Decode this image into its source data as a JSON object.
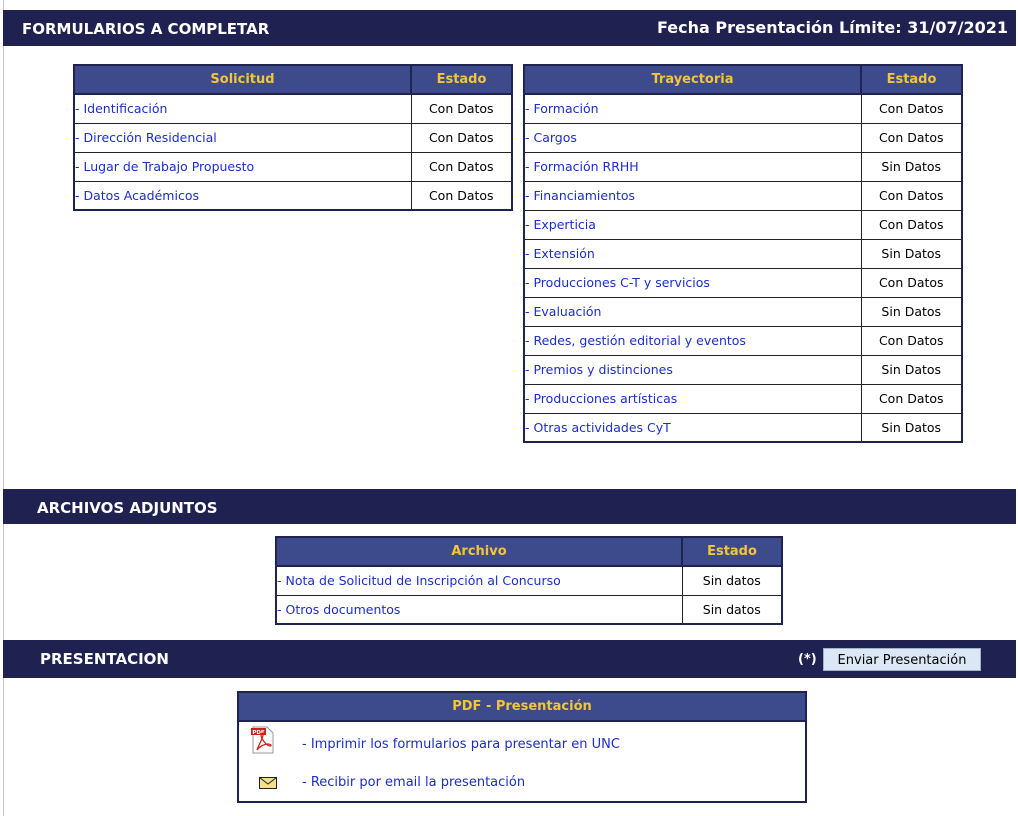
{
  "header": {
    "title": "FORMULARIOS A COMPLETAR",
    "deadline": "Fecha Presentación Límite: 31/07/2021"
  },
  "solicitud": {
    "col1": "Solicitud",
    "col2": "Estado",
    "rows": [
      {
        "label": "- Identificación",
        "status": "Con Datos"
      },
      {
        "label": "- Dirección Residencial",
        "status": "Con Datos"
      },
      {
        "label": "- Lugar de Trabajo Propuesto",
        "status": "Con Datos"
      },
      {
        "label": "- Datos Académicos",
        "status": "Con Datos"
      }
    ]
  },
  "trayectoria": {
    "col1": "Trayectoria",
    "col2": "Estado",
    "rows": [
      {
        "label": "- Formación",
        "status": "Con Datos"
      },
      {
        "label": "- Cargos",
        "status": "Con Datos"
      },
      {
        "label": "- Formación RRHH",
        "status": "Sin Datos"
      },
      {
        "label": "- Financiamientos",
        "status": "Con Datos"
      },
      {
        "label": "- Experticia",
        "status": "Con Datos"
      },
      {
        "label": "- Extensión",
        "status": "Sin Datos"
      },
      {
        "label": "- Producciones C-T y servicios",
        "status": "Con Datos"
      },
      {
        "label": "- Evaluación",
        "status": "Sin Datos"
      },
      {
        "label": "- Redes, gestión editorial y eventos",
        "status": "Con Datos"
      },
      {
        "label": "- Premios y distinciones",
        "status": "Sin Datos"
      },
      {
        "label": "- Producciones artísticas",
        "status": "Con Datos"
      },
      {
        "label": "- Otras actividades CyT",
        "status": "Sin Datos"
      }
    ]
  },
  "archivos": {
    "title": "ARCHIVOS ADJUNTOS",
    "col1": "Archivo",
    "col2": "Estado",
    "rows": [
      {
        "label": "- Nota de Solicitud de Inscripción al Concurso",
        "status": "Sin datos"
      },
      {
        "label": "- Otros documentos",
        "status": "Sin datos"
      }
    ]
  },
  "presentacion": {
    "title": "PRESENTACION",
    "asterisk": "(*)",
    "button": "Enviar Presentación",
    "pdf_title": "PDF - Presentación",
    "print_link": "- Imprimir los formularios para presentar en UNC",
    "email_link": "- Recibir por email la presentación",
    "pdf_icon_text": "PDF"
  }
}
